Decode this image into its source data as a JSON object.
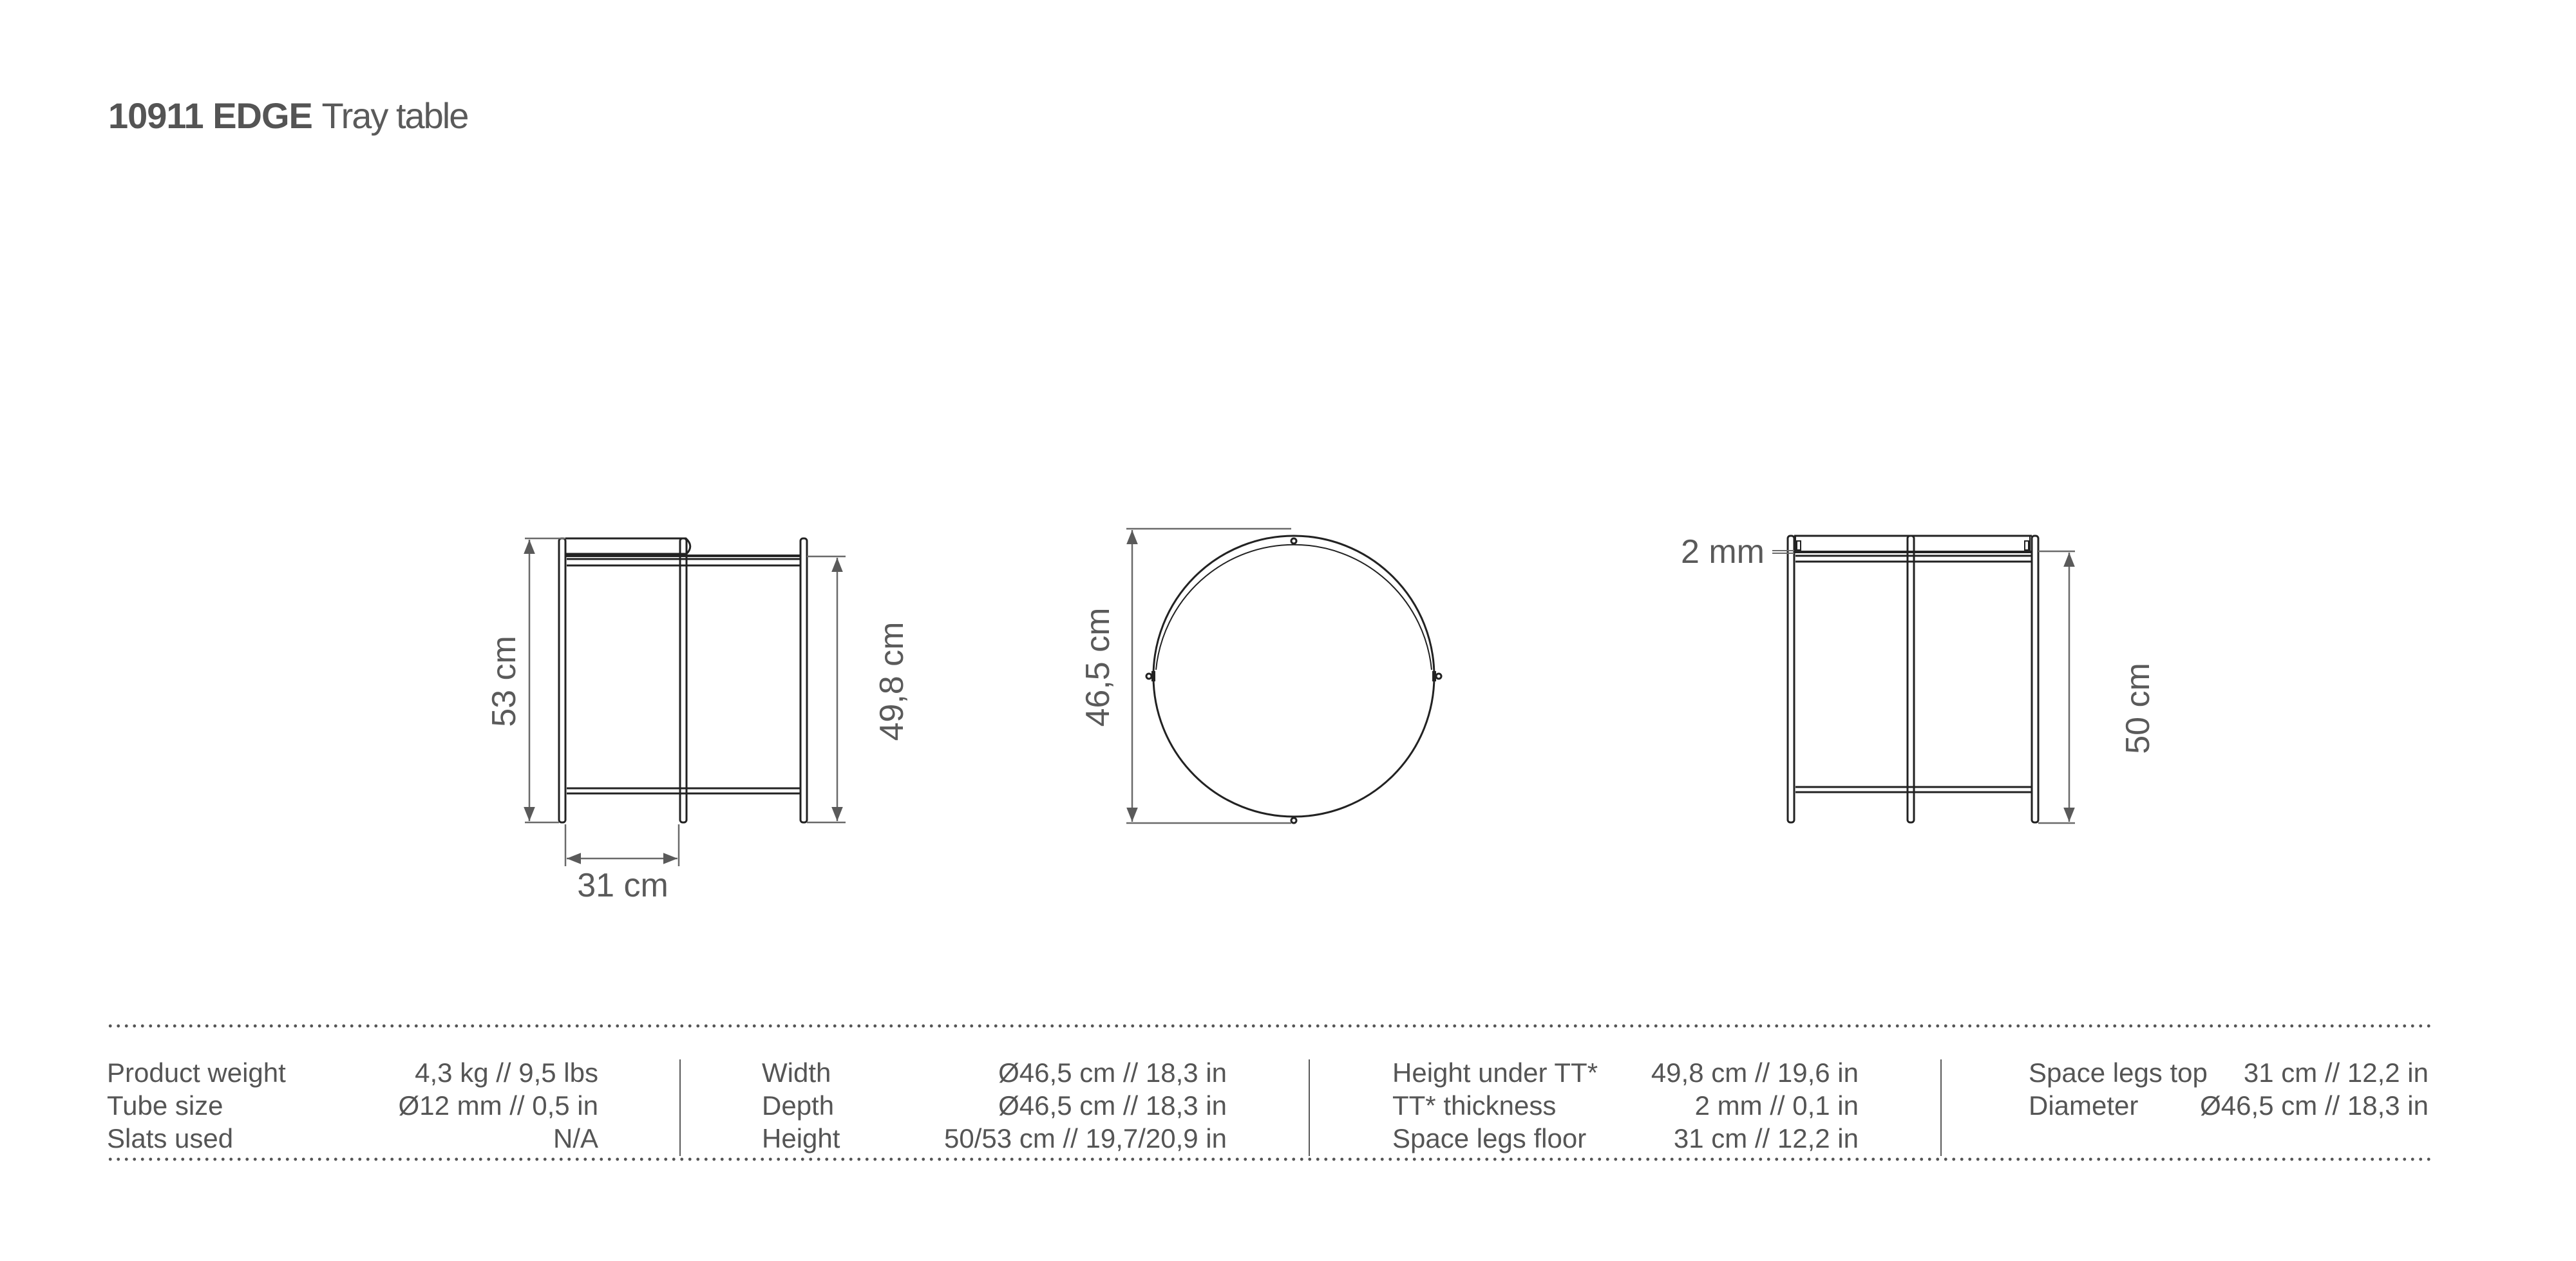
{
  "header": {
    "code": "10911",
    "name": "EDGE",
    "type": "Tray table"
  },
  "drawings": {
    "side_view": {
      "total_height": "53 cm",
      "height_under_tray": "49,8 cm",
      "space_legs": "31 cm"
    },
    "top_view": {
      "diameter": "46,5 cm"
    },
    "front_view": {
      "tray_thickness": "2 mm",
      "height": "50 cm"
    }
  },
  "specs": {
    "columns": [
      {
        "rows": [
          {
            "label": "Product weight",
            "value": "4,3 kg // 9,5 lbs"
          },
          {
            "label": "Tube size",
            "value": "Ø12 mm // 0,5 in"
          },
          {
            "label": "Slats used",
            "value": "N/A"
          }
        ]
      },
      {
        "rows": [
          {
            "label": "Width",
            "value": "Ø46,5 cm // 18,3 in"
          },
          {
            "label": "Depth",
            "value": "Ø46,5 cm // 18,3 in"
          },
          {
            "label": "Height",
            "value": "50/53 cm // 19,7/20,9 in"
          }
        ]
      },
      {
        "rows": [
          {
            "label": "Height under TT*",
            "value": "49,8 cm // 19,6 in"
          },
          {
            "label": "TT* thickness",
            "value": "2 mm // 0,1 in"
          },
          {
            "label": "Space legs floor",
            "value": "31 cm // 12,2 in"
          }
        ]
      },
      {
        "rows": [
          {
            "label": "Space legs top",
            "value": "31 cm // 12,2 in"
          },
          {
            "label": "Diameter",
            "value": "Ø46,5 cm // 18,3 in"
          }
        ]
      }
    ]
  },
  "colors": {
    "text": "#555555",
    "line": "#222222",
    "dimension": "#6a6a6a"
  }
}
